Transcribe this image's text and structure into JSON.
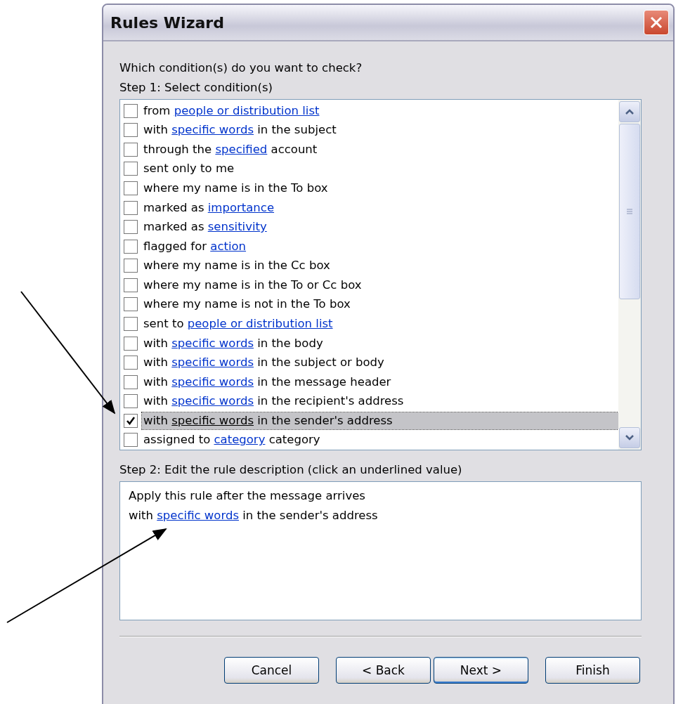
{
  "window": {
    "title": "Rules Wizard"
  },
  "prompt": "Which condition(s) do you want to check?",
  "step1_label": "Step 1: Select condition(s)",
  "conditions": [
    {
      "before": "from ",
      "link": "people or distribution list",
      "checked": false,
      "selected": false
    },
    {
      "before": "with ",
      "link": "specific words",
      "after": " in the subject",
      "checked": false,
      "selected": false
    },
    {
      "before": "through the ",
      "link": "specified",
      "after": " account",
      "checked": false,
      "selected": false
    },
    {
      "before": "sent only to me",
      "checked": false,
      "selected": false
    },
    {
      "before": "where my name is in the To box",
      "checked": false,
      "selected": false
    },
    {
      "before": "marked as ",
      "link": "importance",
      "checked": false,
      "selected": false
    },
    {
      "before": "marked as ",
      "link": "sensitivity",
      "checked": false,
      "selected": false
    },
    {
      "before": "flagged for ",
      "link": "action",
      "checked": false,
      "selected": false
    },
    {
      "before": "where my name is in the Cc box",
      "checked": false,
      "selected": false
    },
    {
      "before": "where my name is in the To or Cc box",
      "checked": false,
      "selected": false
    },
    {
      "before": "where my name is not in the To box",
      "checked": false,
      "selected": false
    },
    {
      "before": "sent to ",
      "link": "people or distribution list",
      "checked": false,
      "selected": false
    },
    {
      "before": "with ",
      "link": "specific words",
      "after": " in the body",
      "checked": false,
      "selected": false
    },
    {
      "before": "with ",
      "link": "specific words",
      "after": " in the subject or body",
      "checked": false,
      "selected": false
    },
    {
      "before": "with ",
      "link": "specific words",
      "after": " in the message header",
      "checked": false,
      "selected": false
    },
    {
      "before": "with ",
      "link": "specific words",
      "after": " in the recipient's address",
      "checked": false,
      "selected": false
    },
    {
      "before": "with ",
      "link": "specific words",
      "after": " in the sender's address",
      "checked": true,
      "selected": true
    },
    {
      "before": "assigned to ",
      "link": "category",
      "after": " category",
      "checked": false,
      "selected": false
    }
  ],
  "step2_label": "Step 2: Edit the rule description (click an underlined value)",
  "description": [
    {
      "before": "Apply this rule after the message arrives"
    },
    {
      "before": "with ",
      "link": "specific words",
      "after": " in the sender's address"
    }
  ],
  "buttons": [
    {
      "label": "Cancel",
      "default": false
    },
    {
      "label": "< Back",
      "default": false
    },
    {
      "label": "Next >",
      "default": true
    },
    {
      "label": "Finish",
      "default": false
    }
  ]
}
